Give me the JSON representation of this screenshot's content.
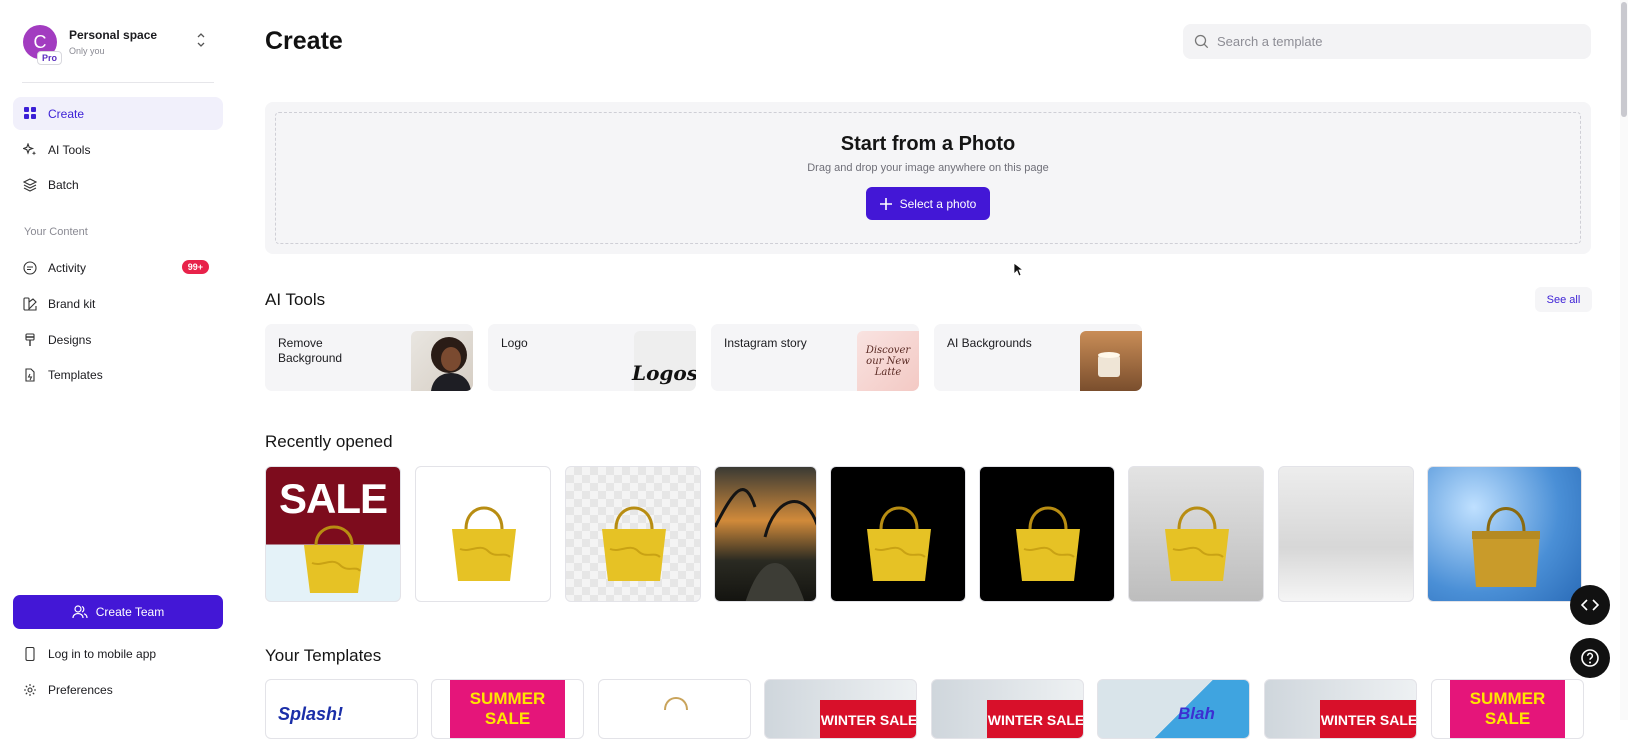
{
  "sidebar": {
    "workspace": {
      "initial": "C",
      "badge": "Pro",
      "title": "Personal space",
      "subtitle": "Only you"
    },
    "nav": [
      {
        "label": "Create",
        "icon": "grid-icon",
        "active": true
      },
      {
        "label": "AI Tools",
        "icon": "sparkle-icon"
      },
      {
        "label": "Batch",
        "icon": "layers-icon"
      }
    ],
    "content_label": "Your Content",
    "content": [
      {
        "label": "Activity",
        "icon": "chat-icon",
        "badge": "99+"
      },
      {
        "label": "Brand kit",
        "icon": "palette-icon"
      },
      {
        "label": "Designs",
        "icon": "brush-icon"
      },
      {
        "label": "Templates",
        "icon": "template-icon"
      }
    ],
    "create_team": "Create Team",
    "mobile": "Log in to mobile app",
    "preferences": "Preferences"
  },
  "header": {
    "title": "Create",
    "search_placeholder": "Search a template"
  },
  "upload": {
    "title": "Start from a Photo",
    "subtitle": "Drag and drop your image anywhere on this page",
    "button": "Select a photo"
  },
  "ai_tools": {
    "title": "AI Tools",
    "see_all": "See all",
    "items": [
      {
        "label": "Remove Background",
        "thumb_text": ""
      },
      {
        "label": "Logo",
        "thumb_text": "Logos"
      },
      {
        "label": "Instagram story",
        "thumb_text": "Discover our New Latte"
      },
      {
        "label": "AI Backgrounds",
        "thumb_text": ""
      }
    ]
  },
  "recent": {
    "title": "Recently opened",
    "items": [
      {
        "kind": "sale",
        "text": "SALE"
      },
      {
        "kind": "white"
      },
      {
        "kind": "transparent"
      },
      {
        "kind": "sunset"
      },
      {
        "kind": "black"
      },
      {
        "kind": "black"
      },
      {
        "kind": "grey"
      },
      {
        "kind": "empty"
      },
      {
        "kind": "blue"
      }
    ]
  },
  "templates": {
    "title": "Your Templates",
    "items": [
      {
        "text": "Splash!"
      },
      {
        "text": "SUMMER SALE"
      },
      {
        "text": ""
      },
      {
        "text": "WINTER SALE"
      },
      {
        "text": "WINTER SALE"
      },
      {
        "text": "Blah"
      },
      {
        "text": "WINTER SALE"
      },
      {
        "text": "SUMMER SALE"
      }
    ]
  },
  "colors": {
    "accent": "#4317d6",
    "badge": "#e8224a",
    "avatar": "#a23cc0"
  }
}
